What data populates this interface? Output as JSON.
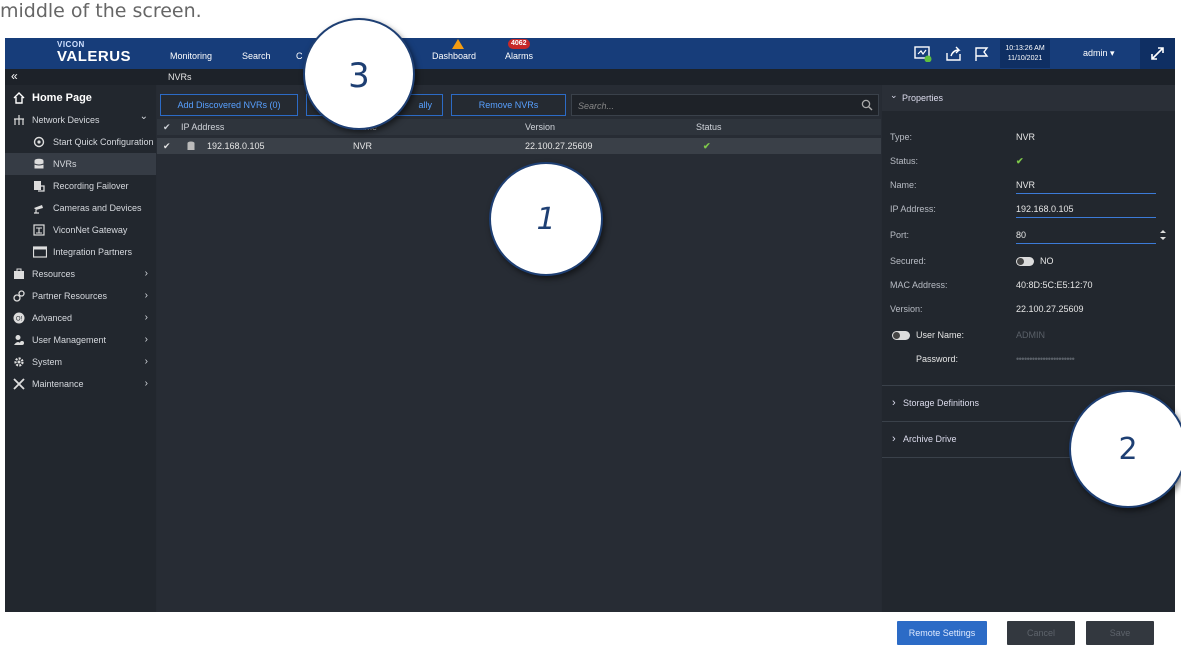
{
  "doc_text": "middle of the screen.",
  "app": {
    "logo_top": "VICON",
    "logo_main": "VALERUS",
    "nav": [
      "Monitoring",
      "Search",
      "C",
      "Dashboard",
      "Alarms"
    ],
    "alarm_count": "4062",
    "clock_time": "10:13:26 AM",
    "clock_date": "11/10/2021",
    "user": "admin",
    "user_caret": "▾",
    "collapse_icon": "«",
    "breadcrumb": "NVRs"
  },
  "sidebar": {
    "items": [
      {
        "label": "Home Page",
        "icon": "home-icon"
      },
      {
        "label": "Network Devices",
        "icon": "network-icon",
        "chevron": "⌄"
      },
      {
        "label": "Start Quick Configuration",
        "icon": "quick-config-icon"
      },
      {
        "label": "NVRs",
        "icon": "database-icon"
      },
      {
        "label": "Recording Failover",
        "icon": "failover-icon"
      },
      {
        "label": "Cameras and Devices",
        "icon": "camera-icon"
      },
      {
        "label": "ViconNet Gateway",
        "icon": "gateway-icon"
      },
      {
        "label": "Integration Partners",
        "icon": "window-icon"
      },
      {
        "label": "Resources",
        "icon": "briefcase-icon",
        "chevron": "›"
      },
      {
        "label": "Partner Resources",
        "icon": "partner-icon",
        "chevron": "›"
      },
      {
        "label": "Advanced",
        "icon": "advanced-icon",
        "chevron": "›"
      },
      {
        "label": "User Management",
        "icon": "users-icon",
        "chevron": "›"
      },
      {
        "label": "System",
        "icon": "gear-icon",
        "chevron": "›"
      },
      {
        "label": "Maintenance",
        "icon": "tools-icon",
        "chevron": "›"
      }
    ]
  },
  "toolbar": {
    "add_discovered": "Add Discovered NVRs (0)",
    "add_manually_partial": "ally",
    "remove": "Remove NVRs",
    "search_placeholder": "Search..."
  },
  "table": {
    "check_header": "✔",
    "headers": [
      "IP Address",
      "Name",
      "Version",
      "Status"
    ],
    "rows": [
      {
        "check": "✔",
        "ip": "192.168.0.105",
        "name": "NVR",
        "version": "22.100.27.25609",
        "status": "✔"
      }
    ]
  },
  "properties": {
    "title": "Properties",
    "chevron": "⌄",
    "type_label": "Type:",
    "type_value": "NVR",
    "status_label": "Status:",
    "status_value": "✔",
    "name_label": "Name:",
    "name_value": "NVR",
    "ip_label": "IP Address:",
    "ip_value": "192.168.0.105",
    "port_label": "Port:",
    "port_value": "80",
    "secured_label": "Secured:",
    "secured_value": "NO",
    "mac_label": "MAC Address:",
    "mac_value": "40:8D:5C:E5:12:70",
    "version_label": "Version:",
    "version_value": "22.100.27.25609",
    "username_label": "User Name:",
    "username_value": "ADMIN",
    "password_label": "Password:",
    "password_value": "••••••••••••••••••••••",
    "storage_label": "Storage Definitions",
    "archive_label": "Archive Drive",
    "section_chevron": "›",
    "remote_settings": "Remote Settings",
    "cancel": "Cancel",
    "save": "Save"
  },
  "callouts": [
    "3",
    "1",
    "2"
  ],
  "colors": {
    "accent": "#2c6bc6",
    "topbar": "#173d7a",
    "ok": "#7ec84a"
  }
}
